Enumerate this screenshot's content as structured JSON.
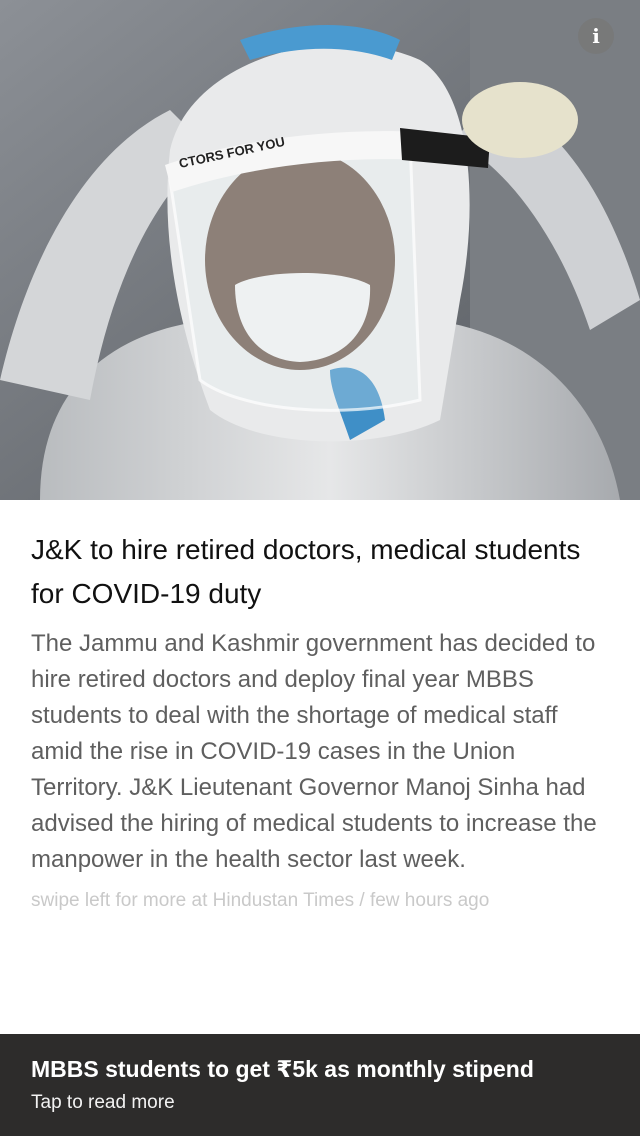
{
  "hero": {
    "image_icon": "doctor-in-ppe-photo",
    "shield_text": "CTORS FOR YOU"
  },
  "info": {
    "icon": "info-icon",
    "glyph": "i"
  },
  "article": {
    "headline": "J&K to hire retired doctors, medical students for COVID-19 duty",
    "body": "The Jammu and Kashmir government has decided to hire retired doctors and deploy final year MBBS students to deal with the shortage of medical staff amid the rise in COVID-19 cases in the Union Territory. J&K Lieutenant Governor Manoj Sinha had advised the hiring of medical students to  increase the manpower in the health sector last week.",
    "source": "swipe left for more at Hindustan Times / few hours ago"
  },
  "footer": {
    "title": "MBBS students to get ₹5k as monthly stipend",
    "subtitle": "Tap to read more"
  },
  "colors": {
    "card_bg": "#ffffff",
    "headline": "#111111",
    "body": "#5f5f5f",
    "source": "#c9c9c9",
    "footer_bg": "#2d2c2b"
  }
}
